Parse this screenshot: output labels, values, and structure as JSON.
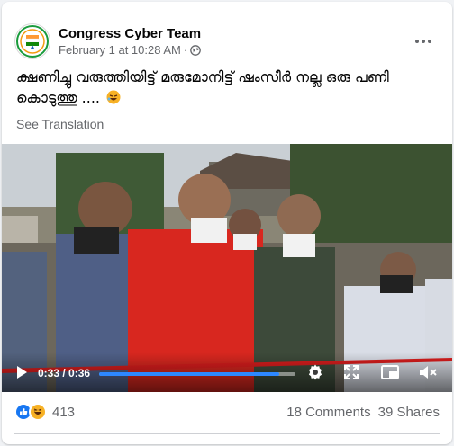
{
  "post": {
    "page_name": "Congress Cyber Team",
    "time": "February 1 at 10:28 AM",
    "separator": "·",
    "text": "ക്ഷണിച്ചു വരുത്തിയിട്ട്  മരുമോനിട്ട് ഷംസീർ നല്ല ഒരു പണി കൊടുത്തു ....",
    "see_translation": "See Translation",
    "audience_icon": "globe-icon",
    "avatar_icon": "congress-logo-icon"
  },
  "video": {
    "time_display": "0:33 / 0:36",
    "progress": 0.917,
    "controls": [
      "play-icon",
      "settings-icon",
      "expand-icon",
      "picture-in-picture-icon",
      "mute-icon"
    ]
  },
  "engagement": {
    "reactions": [
      "like-icon",
      "haha-icon"
    ],
    "reaction_count": "413",
    "comments": "18 Comments",
    "shares": "39 Shares"
  },
  "colors": {
    "accent": "#2d88ff",
    "secondary_text": "#65676b",
    "like_blue": "#1877f2",
    "haha_yellow": "#f7b125"
  }
}
